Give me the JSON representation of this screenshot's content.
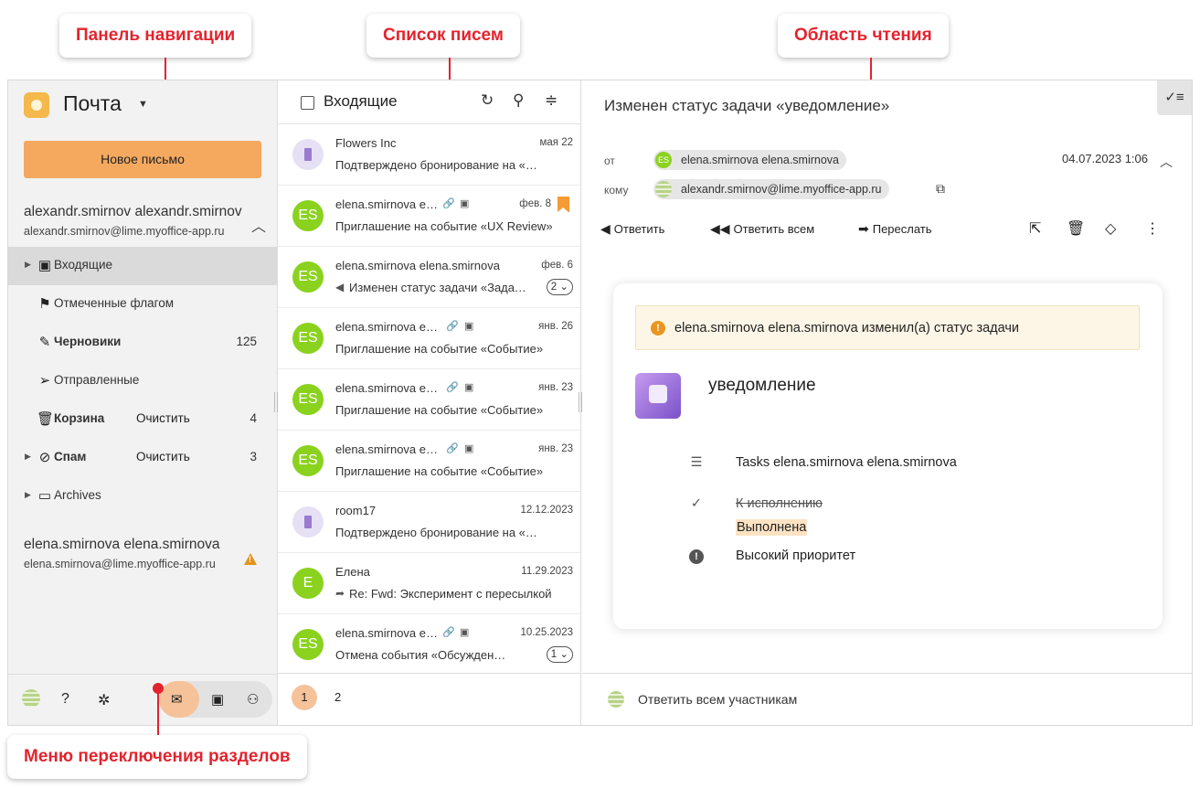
{
  "callouts": {
    "nav": "Панель навигации",
    "list": "Список писем",
    "reading": "Область чтения",
    "switch": "Меню переключения разделов"
  },
  "sidebar": {
    "app_title": "Почта",
    "new_mail": "Новое письмо",
    "account": {
      "name": "alexandr.smirnov alexandr.smirnov",
      "email": "alexandr.smirnov@lime.myoffice-app.ru"
    },
    "folders": [
      {
        "label": "Входящие",
        "icon": "inbox-icon",
        "bold": false
      },
      {
        "label": "Отмеченные флагом",
        "icon": "flag-icon",
        "bold": false
      },
      {
        "label": "Черновики",
        "icon": "drafts-icon",
        "bold": true,
        "count": "125"
      },
      {
        "label": "Отправленные",
        "icon": "sent-icon",
        "bold": false
      },
      {
        "label": "Корзина",
        "icon": "trash-icon",
        "bold": true,
        "action": "Очистить",
        "count": "4"
      },
      {
        "label": "Спам",
        "icon": "spam-icon",
        "bold": true,
        "action": "Очистить",
        "count": "3"
      },
      {
        "label": "Archives",
        "icon": "folder-icon",
        "bold": false
      }
    ],
    "account2": {
      "name": "elena.smirnova elena.smirnova",
      "email": "elena.smirnova@lime.myoffice-app.ru"
    },
    "footer_icons": [
      "avatar",
      "help-icon",
      "settings-icon",
      "mail-icon",
      "calendar-icon",
      "contacts-icon"
    ]
  },
  "list": {
    "title": "Входящие",
    "mails": [
      {
        "from": "Flowers Inc",
        "date": "мая 22",
        "subject": "Подтверждено бронирование на «…",
        "avatar": "",
        "room": true
      },
      {
        "from": "elena.smirnova elena.smirnova",
        "date": "фев. 8",
        "subject": "Приглашение на событие «UX Review»",
        "avatar": "ES",
        "attach": true,
        "bookmark": true
      },
      {
        "from": "elena.smirnova elena.smirnova",
        "date": "фев. 6",
        "subject": "Изменен статус задачи «Задача»",
        "avatar": "ES",
        "reply": true,
        "thread": "2"
      },
      {
        "from": "elena.smirnova elena.smirnova",
        "date": "янв. 26",
        "subject": "Приглашение на событие «Событие»",
        "avatar": "ES",
        "attach": true
      },
      {
        "from": "elena.smirnova elena.smirnova",
        "date": "янв. 23",
        "subject": "Приглашение на событие «Событие»",
        "avatar": "ES",
        "attach": true
      },
      {
        "from": "elena.smirnova elena.smirnova",
        "date": "янв. 23",
        "subject": "Приглашение на событие «Событие»",
        "avatar": "ES",
        "attach": true
      },
      {
        "from": "room17",
        "date": "12.12.2023",
        "subject": "Подтверждено бронирование на «…",
        "avatar": "",
        "room": true
      },
      {
        "from": "Елена",
        "date": "11.29.2023",
        "subject": "Re: Fwd: Эксперимент с пересылкой",
        "avatar": "E",
        "forward": true
      },
      {
        "from": "elena.smirnova elena.smirnova",
        "date": "10.25.2023",
        "subject": "Отмена события «Обсуждение»",
        "avatar": "ES",
        "attach": true,
        "thread": "1"
      }
    ],
    "pages": [
      "1",
      "2"
    ]
  },
  "reading": {
    "subject": "Изменен статус задачи «уведомление»",
    "from_label": "от",
    "to_label": "кому",
    "from": "elena.smirnova elena.smirnova",
    "from_initials": "ES",
    "to": "alexandr.smirnov@lime.myoffice-app.ru",
    "date": "04.07.2023 1:06",
    "actions": {
      "reply": "Ответить",
      "reply_all": "Ответить всем",
      "forward": "Переслать"
    },
    "notice_name": "elena.smirnova elena.smirnova",
    "notice_text": " изменил(а) статус задачи",
    "task_title": "уведомление",
    "task_list": "Tasks elena.smirnova elena.smirnova",
    "status_old": "К исполнению",
    "status_new": "Выполнена",
    "priority": "Высокий приоритет",
    "footer": "Ответить всем участникам"
  }
}
